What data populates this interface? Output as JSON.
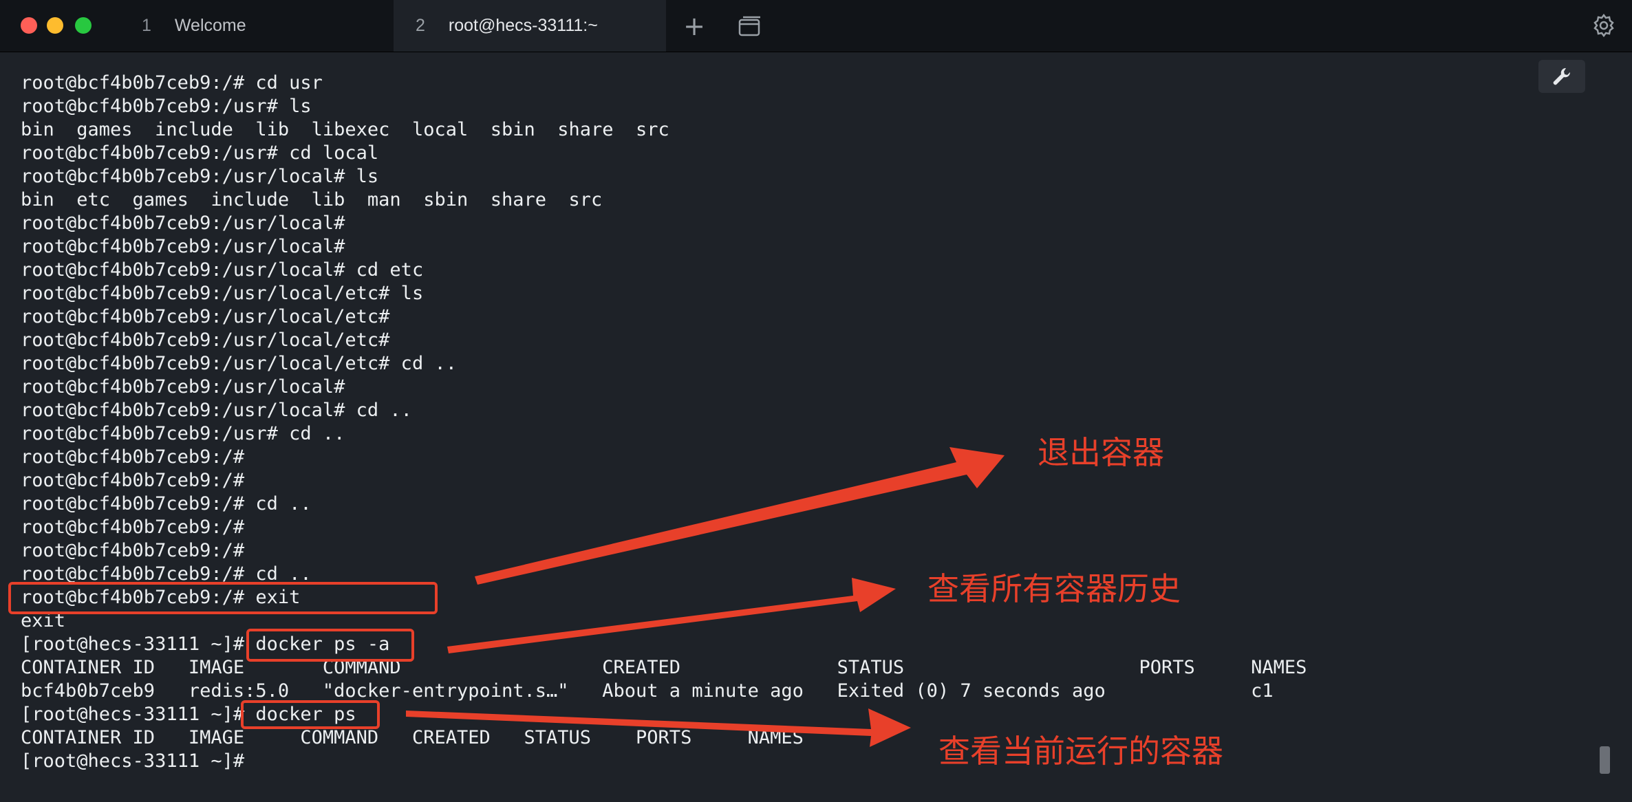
{
  "tabs": [
    {
      "number": "1",
      "label": "Welcome"
    },
    {
      "number": "2",
      "label": "root@hecs-33111:~"
    }
  ],
  "icons": {
    "new_tab": "plus-icon",
    "window": "window-icon",
    "settings": "gear-icon",
    "tools": "wrench-icon"
  },
  "terminal": {
    "lines": [
      "root@bcf4b0b7ceb9:/# cd usr",
      "root@bcf4b0b7ceb9:/usr# ls",
      "bin  games  include  lib  libexec  local  sbin  share  src",
      "root@bcf4b0b7ceb9:/usr# cd local",
      "root@bcf4b0b7ceb9:/usr/local# ls",
      "bin  etc  games  include  lib  man  sbin  share  src",
      "root@bcf4b0b7ceb9:/usr/local#",
      "root@bcf4b0b7ceb9:/usr/local#",
      "root@bcf4b0b7ceb9:/usr/local# cd etc",
      "root@bcf4b0b7ceb9:/usr/local/etc# ls",
      "root@bcf4b0b7ceb9:/usr/local/etc#",
      "root@bcf4b0b7ceb9:/usr/local/etc#",
      "root@bcf4b0b7ceb9:/usr/local/etc# cd ..",
      "root@bcf4b0b7ceb9:/usr/local#",
      "root@bcf4b0b7ceb9:/usr/local# cd ..",
      "root@bcf4b0b7ceb9:/usr# cd ..",
      "root@bcf4b0b7ceb9:/#",
      "root@bcf4b0b7ceb9:/#",
      "root@bcf4b0b7ceb9:/# cd ..",
      "root@bcf4b0b7ceb9:/#",
      "root@bcf4b0b7ceb9:/#",
      "root@bcf4b0b7ceb9:/# cd ..",
      "root@bcf4b0b7ceb9:/# exit",
      "exit",
      "[root@hecs-33111 ~]# docker ps -a",
      "CONTAINER ID   IMAGE       COMMAND                  CREATED              STATUS                     PORTS     NAMES",
      "bcf4b0b7ceb9   redis:5.0   \"docker-entrypoint.s…\"   About a minute ago   Exited (0) 7 seconds ago             c1",
      "[root@hecs-33111 ~]# docker ps",
      "CONTAINER ID   IMAGE     COMMAND   CREATED   STATUS    PORTS     NAMES",
      "[root@hecs-33111 ~]#"
    ]
  },
  "annotations": {
    "exit_container": "退出容器",
    "view_all_history": "查看所有容器历史",
    "view_running": "查看当前运行的容器"
  },
  "colors": {
    "annotation_red": "#e8402a",
    "terminal_bg": "#1e2228",
    "terminal_fg": "#eceff1"
  }
}
